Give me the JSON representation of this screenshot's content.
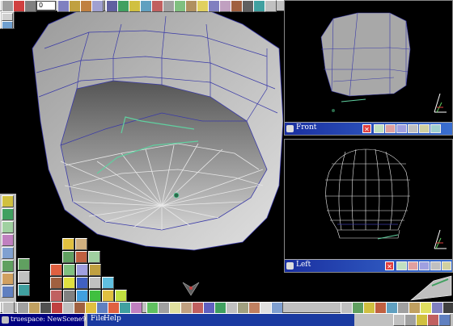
{
  "toolbar": {
    "frame_value": "0"
  },
  "viewports": {
    "front": {
      "label": "Front"
    },
    "left": {
      "label": "Left"
    }
  },
  "taskbar": {
    "title": "truespace: NewScene9",
    "menu_file": "File",
    "menu_help": "Help"
  },
  "colors": {
    "viewport_bar": "#1a2fa0",
    "wire_blue": "#3a3aa8",
    "selection_green": "#60d0a0",
    "mesh_gray": "#b8b8b8"
  }
}
